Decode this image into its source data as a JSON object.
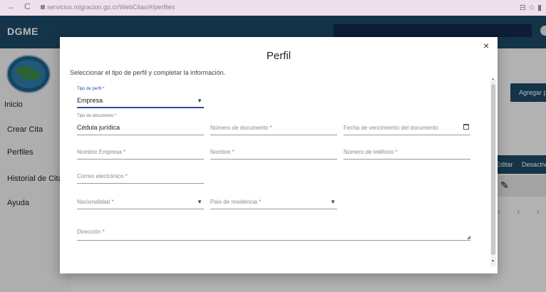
{
  "browser": {
    "back": "→",
    "reload": "C",
    "url": "servicios.migracion.go.cr/WebCitas/#/perfiles",
    "icons": "⊟ ☆ ▮"
  },
  "header": {
    "brand": "DGME"
  },
  "sidebar": {
    "items": [
      {
        "label": "Inicio"
      },
      {
        "label": "Crear Cita"
      },
      {
        "label": "Perfiles"
      },
      {
        "label": "Historial de Citas"
      },
      {
        "label": "Ayuda"
      }
    ]
  },
  "background": {
    "add_button": "Agregar p",
    "table_headers": [
      "Editar",
      "Desactiv"
    ],
    "pager": "‹ ‹ ›"
  },
  "dialog": {
    "close": "×",
    "title": "Perfil",
    "subtitle": "Seleccionar el tipo de perfil y completar la información.",
    "fields": {
      "tipo_perfil": {
        "label": "Tipo de perfil *",
        "value": "Empresa"
      },
      "tipo_documento": {
        "label": "Tipo de documento *",
        "value": "Cédula jurídica"
      },
      "numero_documento": {
        "placeholder": "Número de documento *"
      },
      "fecha_vencimiento": {
        "placeholder": "Fecha de vencimiento del documento"
      },
      "nombre_empresa": {
        "placeholder": "Nombre Empresa *"
      },
      "nombre": {
        "placeholder": "Nombre *"
      },
      "telefono": {
        "placeholder": "Número de teléfono *"
      },
      "correo": {
        "placeholder": "Correo electrónico *"
      },
      "nacionalidad": {
        "placeholder": "Nacionalidad *"
      },
      "pais_residencia": {
        "placeholder": "País de residencia *"
      },
      "direccion": {
        "placeholder": "Dirección *"
      }
    }
  },
  "colors": {
    "header": "#1d4a66",
    "focus": "#3549a8",
    "browser_bar": "#efe0ec"
  },
  "icons": {
    "close": "close-icon",
    "dropdown": "chevron-down-icon",
    "calendar": "calendar-icon",
    "edit": "pencil-icon"
  }
}
